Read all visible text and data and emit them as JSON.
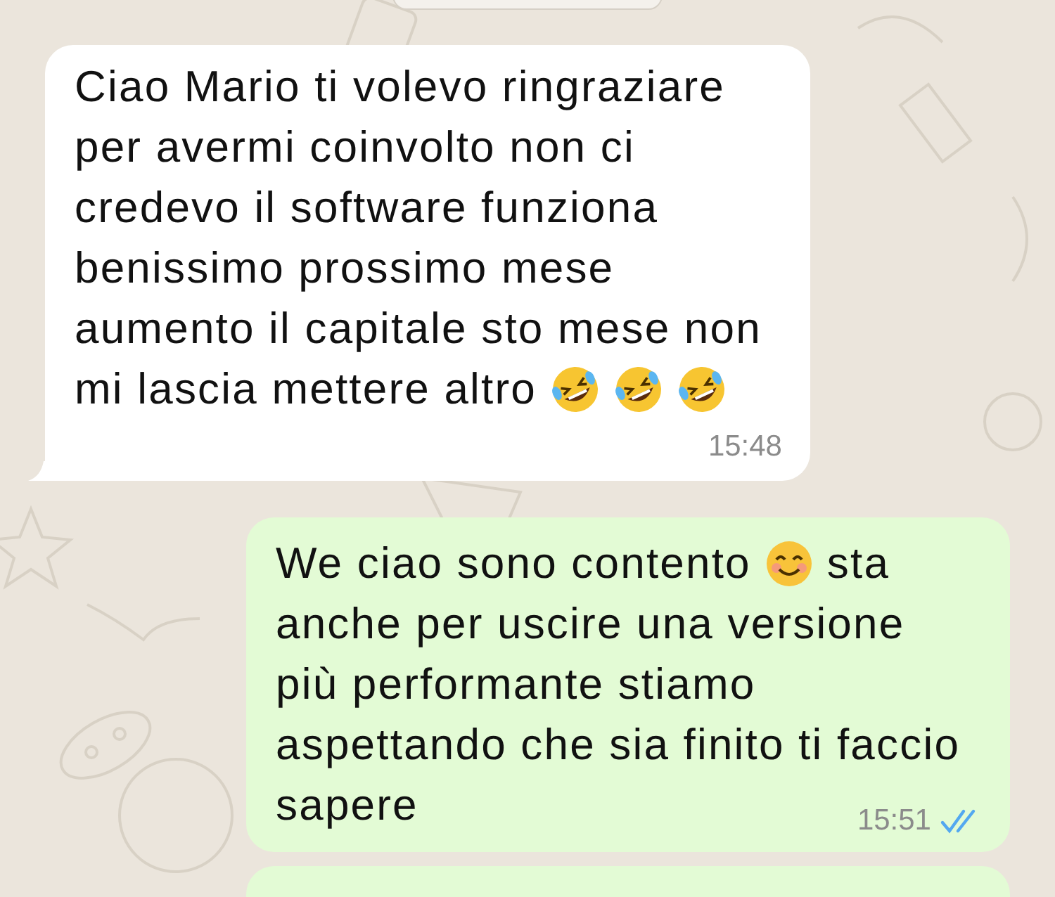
{
  "messages": [
    {
      "kind": "incoming",
      "time": "15:48",
      "lines": [
        [
          {
            "kind": "text",
            "text": "Ciao Mario ti volevo ringraziare"
          }
        ],
        [
          {
            "kind": "text",
            "text": "per avermi coinvolto non ci"
          }
        ],
        [
          {
            "kind": "text",
            "text": "credevo il software funziona"
          }
        ],
        [
          {
            "kind": "text",
            "text": "benissimo prossimo mese"
          }
        ],
        [
          {
            "kind": "text",
            "text": "aumento il capitale sto mese non"
          }
        ],
        [
          {
            "kind": "text",
            "text": "mi lascia mettere altro"
          },
          {
            "kind": "rofl"
          },
          {
            "kind": "rofl"
          },
          {
            "kind": "rofl"
          }
        ]
      ]
    },
    {
      "kind": "outgoing",
      "time": "15:51",
      "read": true,
      "lines": [
        [
          {
            "kind": "text",
            "text": "We ciao sono contento"
          },
          {
            "kind": "smile"
          },
          {
            "kind": "text",
            "text": "sta"
          }
        ],
        [
          {
            "kind": "text",
            "text": "anche per uscire una versione"
          }
        ],
        [
          {
            "kind": "text",
            "text": "più performante stiamo"
          }
        ],
        [
          {
            "kind": "text",
            "text": "aspettando che sia finito ti faccio"
          }
        ],
        [
          {
            "kind": "text",
            "text": "sapere"
          }
        ]
      ]
    }
  ]
}
